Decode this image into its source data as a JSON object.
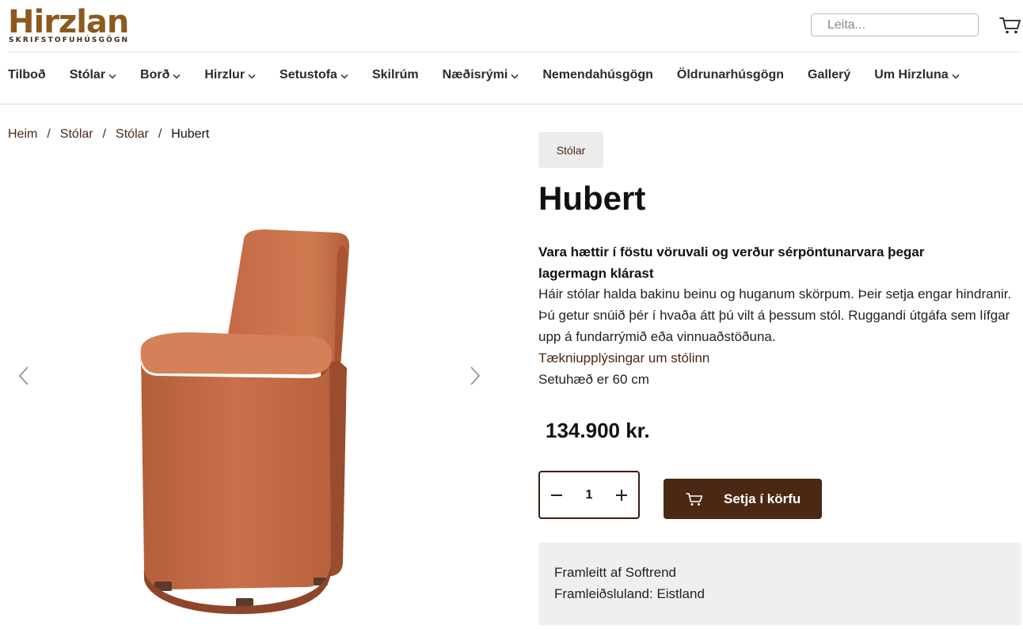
{
  "brand": {
    "name": "Hirzlan",
    "tagline": "SKRIFSTOFUHÚSGÖGN",
    "color": "#8c5a1e"
  },
  "search": {
    "placeholder": "Leita..."
  },
  "nav": {
    "items": [
      {
        "label": "Tilboð",
        "dropdown": false
      },
      {
        "label": "Stólar",
        "dropdown": true
      },
      {
        "label": "Borð",
        "dropdown": true
      },
      {
        "label": "Hirzlur",
        "dropdown": true
      },
      {
        "label": "Setustofa",
        "dropdown": true
      },
      {
        "label": "Skilrúm",
        "dropdown": false
      },
      {
        "label": "Næðisrými",
        "dropdown": true
      },
      {
        "label": "Nemendahúsgögn",
        "dropdown": false
      },
      {
        "label": "Öldrunarhúsgögn",
        "dropdown": false
      },
      {
        "label": "Gallerý",
        "dropdown": false
      },
      {
        "label": "Um Hirzluna",
        "dropdown": true
      }
    ]
  },
  "breadcrumb": {
    "items": [
      "Heim",
      "Stólar",
      "Stólar"
    ],
    "current": "Hubert",
    "separator": "/"
  },
  "product": {
    "category_badge": "Stólar",
    "title": "Hubert",
    "notice": "Vara hættir í föstu vöruvali og verður sérpöntunarvara þegar lagermagn klárast",
    "description": "Háir stólar halda bakinu beinu og huganum skörpum. Þeir setja engar hindranir. Þú getur snúið þér í hvaða átt þú vilt á þessum stól. Ruggandi útgáfa sem lífgar upp á fundarrýmið eða vinnuaðstöðuna.",
    "spec_link": "Tækniupplýsingar um stólinn",
    "seat_height": "Setuhæð er 60 cm",
    "price": "134.900 kr.",
    "quantity": "1",
    "add_to_cart": "Setja í körfu",
    "manufacturer": "Framleitt af Softrend",
    "origin": "Framleiðsluland: Eistland",
    "image_color": "#c8704a"
  },
  "colors": {
    "accent": "#4a2814",
    "link": "#4a2814",
    "badge_bg": "#ececec",
    "info_bg": "#efefef"
  }
}
